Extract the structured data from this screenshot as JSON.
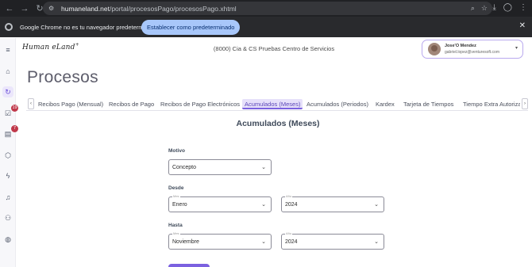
{
  "browser": {
    "url_host": "humaneland.net",
    "url_path": "/portal/procesosPago/procesosPago.xhtml",
    "infobar_message": "Google Chrome no es tu navegador predeterminado",
    "infobar_button": "Establecer como predeterminado"
  },
  "header": {
    "logo": "Human eLand",
    "company": "(8000) Cia & CS Pruebas Centro de Servicios",
    "user_name": "Jose'O Mendez",
    "user_email": "gabriel.lopez@venturesoft.com"
  },
  "sidebar": {
    "badges": {
      "tasks": "19",
      "orders": "7"
    }
  },
  "page": {
    "title": "Procesos"
  },
  "tabs": [
    {
      "label": "Recibos Pago (Mensual)"
    },
    {
      "label": "Recibos de Pago"
    },
    {
      "label": "Recibos de Pago Electrónicos"
    },
    {
      "label": "Acumulados (Meses)"
    },
    {
      "label": "Acumulados (Periodos)"
    },
    {
      "label": "Kardex"
    },
    {
      "label": "Tarjeta de Tiempos"
    },
    {
      "label": "Tiempo Extra Autorizado"
    }
  ],
  "form": {
    "title": "Acumulados (Meses)",
    "motivo_label": "Motivo",
    "motivo_value": "Concepto",
    "desde_label": "Desde",
    "desde_mes_float": "Mes",
    "desde_mes": "Enero",
    "desde_anio_float": "Año",
    "desde_anio": "2024",
    "hasta_label": "Hasta",
    "hasta_mes_float": "Mes",
    "hasta_mes": "Noviembre",
    "hasta_anio_float": "Año",
    "hasta_anio": "2024"
  },
  "colors": {
    "accent": "#7b61e0",
    "active_tab_bg": "#e6e0fa",
    "badge": "#c0384a"
  }
}
